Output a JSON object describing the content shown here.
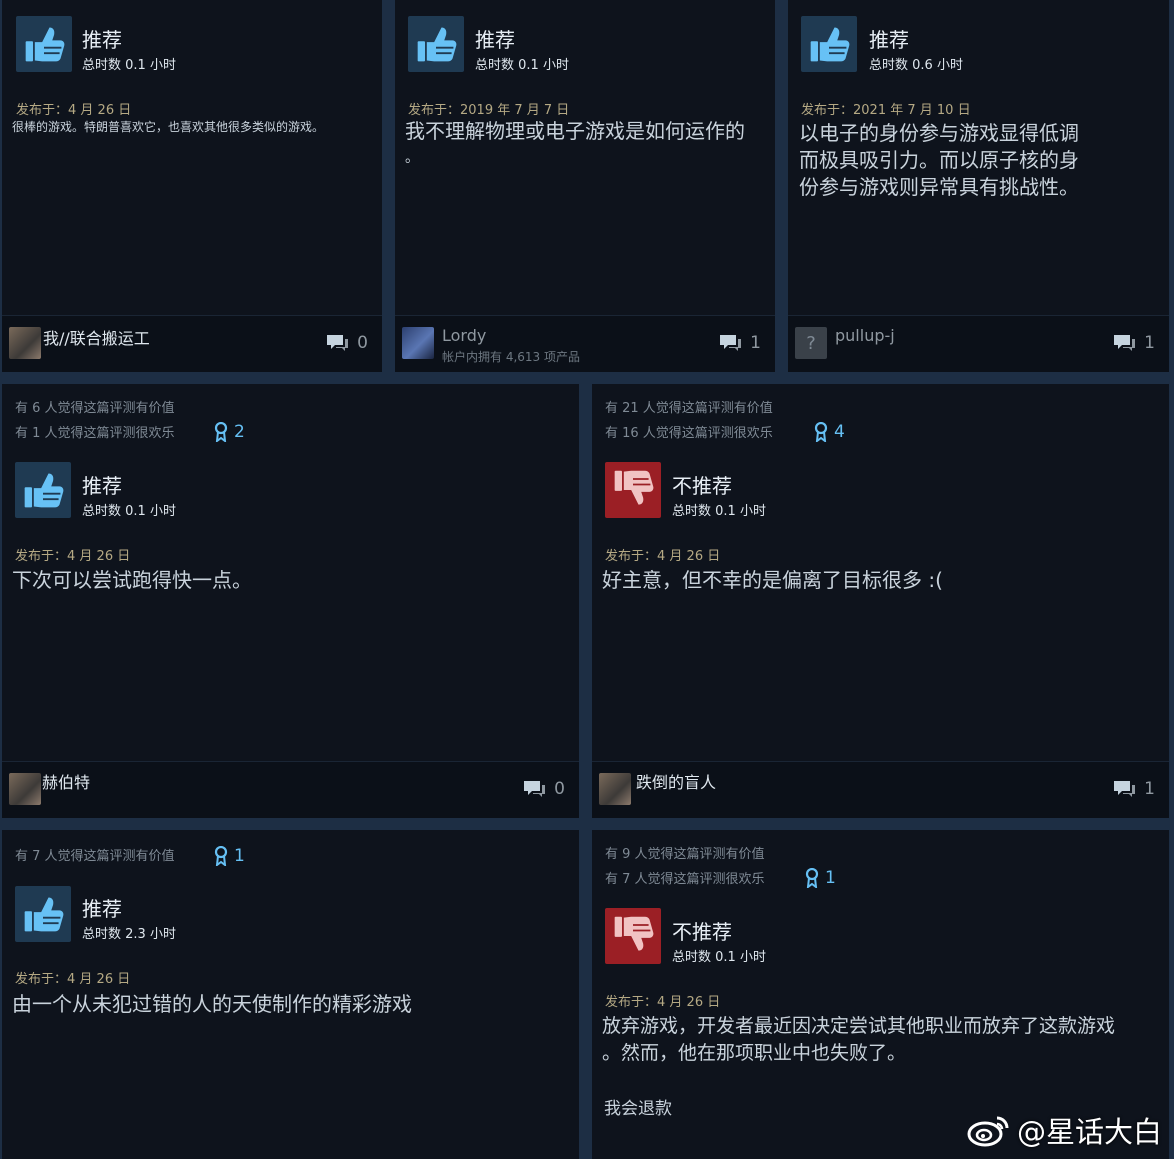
{
  "reviews": [
    {
      "helpful": "",
      "funny": "",
      "awards": "",
      "verdict": "推荐",
      "hours": "总时数 0.1 小时",
      "posted_label": "发布于：",
      "posted_date": "4 月 26 日",
      "text": "很棒的游戏。特朗普喜欢它，也喜欢其他很多类似的游戏。",
      "author": "我//联合搬运工",
      "author_sub": "",
      "comment_count": "0"
    },
    {
      "helpful": "",
      "funny": "",
      "awards": "",
      "verdict": "推荐",
      "hours": "总时数 0.1 小时",
      "posted_label": "发布于：",
      "posted_date": "2019 年 7 月 7 日",
      "text": "我不理解物理或电子游戏是如何运作的",
      "text2": "。",
      "author": "Lordy",
      "author_sub": "帐户内拥有 4,613 项产品",
      "comment_count": "1"
    },
    {
      "helpful": "",
      "funny": "",
      "awards": "",
      "verdict": "推荐",
      "hours": "总时数 0.6 小时",
      "posted_label": "发布于：",
      "posted_date": "2021 年 7 月 10 日",
      "text": "以电子的身份参与游戏显得低调",
      "text2": "而极具吸引力。而以原子核的身",
      "text3": "份参与游戏则异常具有挑战性。",
      "author": "pullup-j",
      "author_sub": "",
      "comment_count": "1"
    },
    {
      "helpful": "有 6 人觉得这篇评测有价值",
      "funny": "有 1 人觉得这篇评测很欢乐",
      "awards": "2",
      "verdict": "推荐",
      "hours": "总时数 0.1 小时",
      "posted_label": "发布于：",
      "posted_date": "4 月 26 日",
      "text": "下次可以尝试跑得快一点。",
      "author": "赫伯特",
      "author_sub": "",
      "comment_count": "0"
    },
    {
      "helpful": "有 21 人觉得这篇评测有价值",
      "funny": "有 16 人觉得这篇评测很欢乐",
      "awards": "4",
      "verdict": "不推荐",
      "hours": "总时数 0.1 小时",
      "posted_label": "发布于：",
      "posted_date": "4 月 26 日",
      "text": "好主意，但不幸的是偏离了目标很多 :(",
      "author": "跌倒的盲人",
      "author_sub": "",
      "comment_count": "1"
    },
    {
      "helpful": "有 7 人觉得这篇评测有价值",
      "funny": "",
      "awards": "1",
      "verdict": "推荐",
      "hours": "总时数 2.3 小时",
      "posted_label": "发布于：",
      "posted_date": "4 月 26 日",
      "text": "由一个从未犯过错的人的天使制作的精彩游戏"
    },
    {
      "helpful": "有 9 人觉得这篇评测有价值",
      "funny": "有 7 人觉得这篇评测很欢乐",
      "awards": "1",
      "verdict": "不推荐",
      "hours": "总时数 0.1 小时",
      "posted_label": "发布于：",
      "posted_date": "4 月 26 日",
      "text": "放弃游戏，开发者最近因决定尝试其他职业而放弃了这款游戏",
      "text2": "。然而，他在那项职业中也失败了。",
      "text3": "我会退款"
    }
  ],
  "watermark": "@星话大白",
  "colors": {
    "accent": "#66c0f4",
    "thumb_up_bg": "#1f3a52",
    "thumb_down_bg": "#9b1f25",
    "posted": "#b5a984"
  },
  "icons": {
    "up": "thumbs-up-icon",
    "down": "thumbs-down-icon",
    "award": "award-ribbon-icon",
    "comment": "comment-bubble-icon"
  }
}
